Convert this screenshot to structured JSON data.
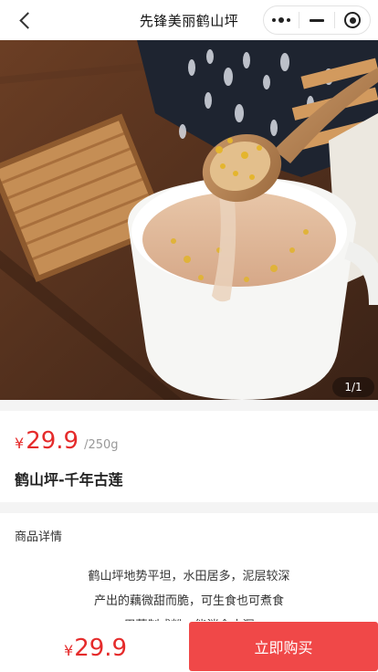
{
  "nav": {
    "title": "先锋美丽鹤山坪"
  },
  "hero": {
    "indicator": "1/1"
  },
  "product": {
    "currency": "¥",
    "price": "29.9",
    "unit": "/250g",
    "name": "鹤山坪-千年古莲"
  },
  "detail": {
    "title": "商品详情",
    "lines": [
      "鹤山坪地势平坦，水田居多，泥层较深",
      "产出的藕微甜而脆，可生食也可煮食",
      "用藕制成粉，能消食止泻"
    ]
  },
  "bottom": {
    "currency": "¥",
    "price": "29.9",
    "buy_label": "立即购买"
  },
  "colors": {
    "accent": "#f04848",
    "price": "#e52b2b"
  }
}
